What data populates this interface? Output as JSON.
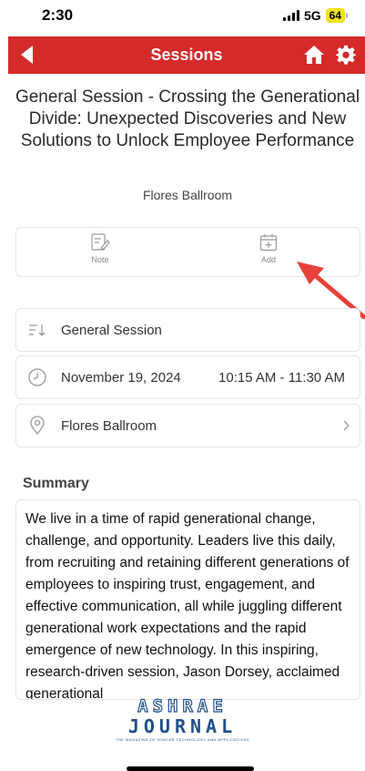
{
  "status_bar": {
    "time": "2:30",
    "network": "5G",
    "battery": "64"
  },
  "nav": {
    "title": "Sessions"
  },
  "session": {
    "title": "General Session - Crossing the Generational Divide: Unexpected Discoveries and New Solutions to Unlock Employee Performance",
    "room": "Flores Ballroom"
  },
  "actions": {
    "note_label": "Note",
    "add_label": "Add"
  },
  "info": {
    "track": "General Session",
    "date": "November 19, 2024",
    "time_range": "10:15 AM - 11:30 AM",
    "location": "Flores Ballroom"
  },
  "summary": {
    "heading": "Summary",
    "text": "We live in a time of rapid generational change, challenge, and opportunity. Leaders live this daily, from recruiting and retaining different generations of employees to inspiring trust, engagement, and effective communication, all while juggling different generational work expectations and the rapid emergence of new technology. In this inspiring, research-driven session, Jason Dorsey, acclaimed generational"
  },
  "logo": {
    "line1": "ASHRAE",
    "line2": "JOURNAL",
    "tagline": "THE MAGAZINE OF HVAC&R TECHNOLOGY AND APPLICATIONS"
  },
  "colors": {
    "nav_bg": "#d42a2a",
    "annotation_arrow": "#e8403a",
    "logo_blue": "#1f4f8c"
  },
  "icons": {
    "back": "back-arrow-icon",
    "home": "home-icon",
    "settings": "gear-icon",
    "note": "note-edit-icon",
    "add": "calendar-add-icon",
    "track": "sort-lines-icon",
    "clock": "clock-icon",
    "location": "map-pin-icon",
    "chevron": "chevron-right-icon"
  }
}
